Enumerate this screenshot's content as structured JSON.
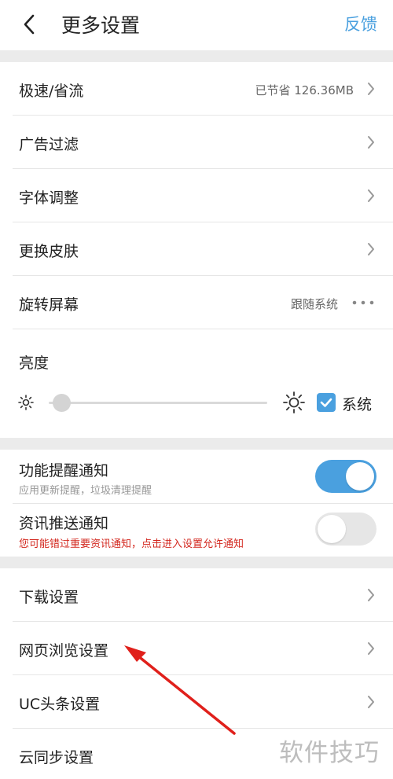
{
  "header": {
    "title": "更多设置",
    "feedback": "反馈"
  },
  "section1": {
    "speed": {
      "label": "极速/省流",
      "value": "已节省 126.36MB"
    },
    "ad_filter": {
      "label": "广告过滤"
    },
    "font": {
      "label": "字体调整"
    },
    "skin": {
      "label": "更换皮肤"
    },
    "rotate": {
      "label": "旋转屏幕",
      "value": "跟随系统"
    },
    "brightness": {
      "label": "亮度",
      "level": 0.03,
      "system_checked": true,
      "system_label": "系统"
    }
  },
  "section2": {
    "feature_notice": {
      "label": "功能提醒通知",
      "sub": "应用更新提醒，垃圾清理提醒",
      "enabled": true
    },
    "news_notice": {
      "label": "资讯推送通知",
      "sub": "您可能错过重要资讯通知，点击进入设置允许通知",
      "enabled": false
    }
  },
  "section3": {
    "download": {
      "label": "下载设置"
    },
    "web_browse": {
      "label": "网页浏览设置"
    },
    "uc_headline": {
      "label": "UC头条设置"
    },
    "cloud_sync": {
      "label": "云同步设置"
    }
  },
  "watermark": "软件技巧",
  "colors": {
    "accent": "#4aa0df",
    "warning": "#d3281f",
    "annotation_arrow": "#e0201b"
  }
}
